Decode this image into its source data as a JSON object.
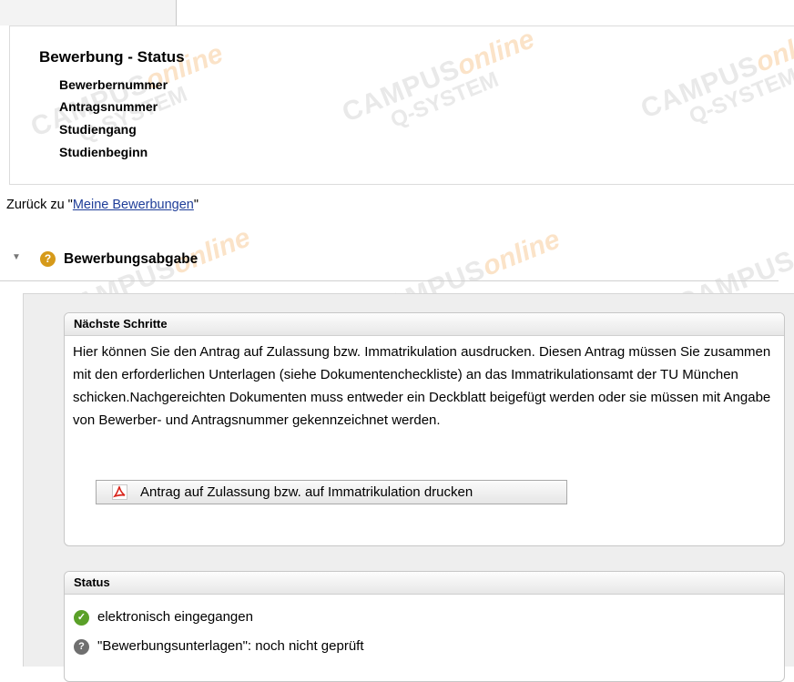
{
  "header": {
    "title": "Bewerbung - Status",
    "rows": [
      "Bewerbernummer",
      "Antragsnummer",
      "Studiengang",
      "Studienbeginn"
    ]
  },
  "watermark": {
    "campus": "CAMPUS",
    "online": "online",
    "qsystem": "Q-SYSTEM"
  },
  "back": {
    "prefix": "Zurück zu \"",
    "link": "Meine Bewerbungen",
    "suffix": "\""
  },
  "section": {
    "title": "Bewerbungsabgabe",
    "status_icon": "question-icon",
    "expanded": true
  },
  "steps": {
    "title": "Nächste Schritte",
    "text": "Hier können Sie den Antrag auf Zulassung bzw. Immatrikulation ausdrucken. Diesen Antrag müssen Sie zusammen mit den erforderlichen Unterlagen (siehe Dokumentencheckliste) an das Immatrikulationsamt der TU München schicken.Nachgereichten Dokumenten muss entweder ein Deckblatt beigefügt werden oder sie müssen mit Angabe von Bewerber- und Antragsnummer gekennzeichnet werden.",
    "button_label": "Antrag auf Zulassung bzw. auf Immatrikulation drucken",
    "button_icon": "pdf-icon"
  },
  "status": {
    "title": "Status",
    "items": [
      {
        "icon": "check-icon",
        "label": "elektronisch eingegangen"
      },
      {
        "icon": "question-icon",
        "label": "\"Bewerbungsunterlagen\": noch nicht geprüft"
      }
    ]
  },
  "colors": {
    "link": "#1f3e99",
    "question_icon": "#d69a1a",
    "check_icon": "#5aa028",
    "watermark_orange": "#fbe3c8"
  }
}
